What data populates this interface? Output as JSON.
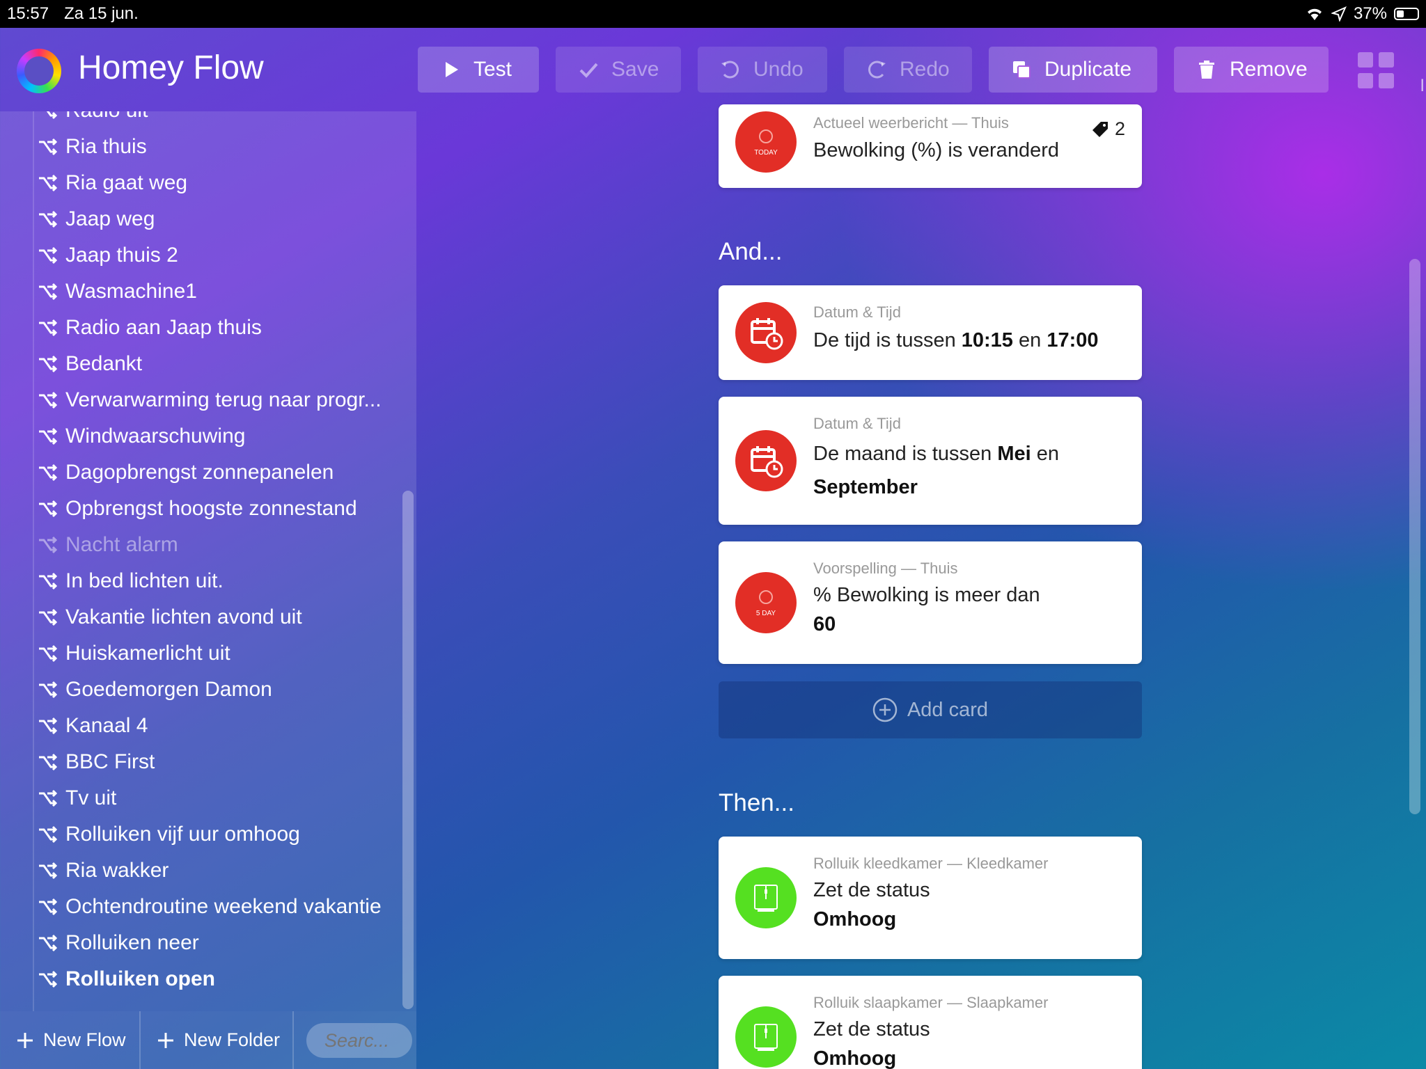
{
  "status_bar": {
    "time": "15:57",
    "date": "Za 15 jun.",
    "battery": "37%"
  },
  "app": {
    "title": "Homey Flow"
  },
  "toolbar": {
    "test": "Test",
    "save": "Save",
    "undo": "Undo",
    "redo": "Redo",
    "duplicate": "Duplicate",
    "remove": "Remove"
  },
  "sidebar": {
    "items": [
      {
        "label": "Radio uit",
        "state": "normal"
      },
      {
        "label": "Ria thuis",
        "state": "normal"
      },
      {
        "label": "Ria gaat weg",
        "state": "normal"
      },
      {
        "label": "Jaap weg",
        "state": "normal"
      },
      {
        "label": "Jaap thuis 2",
        "state": "normal"
      },
      {
        "label": "Wasmachine1",
        "state": "normal"
      },
      {
        "label": "Radio aan Jaap thuis",
        "state": "normal"
      },
      {
        "label": "Bedankt",
        "state": "normal"
      },
      {
        "label": "Verwarwarming terug naar progr...",
        "state": "normal"
      },
      {
        "label": "Windwaarschuwing",
        "state": "normal"
      },
      {
        "label": "Dagopbrengst zonnepanelen",
        "state": "normal"
      },
      {
        "label": "Opbrengst hoogste zonnestand",
        "state": "normal"
      },
      {
        "label": "Nacht alarm",
        "state": "disabled"
      },
      {
        "label": "In bed lichten uit.",
        "state": "normal"
      },
      {
        "label": "Vakantie lichten avond uit",
        "state": "normal"
      },
      {
        "label": "Huiskamerlicht uit",
        "state": "normal"
      },
      {
        "label": "Goedemorgen Damon",
        "state": "normal"
      },
      {
        "label": "Kanaal 4",
        "state": "normal"
      },
      {
        "label": "BBC First",
        "state": "normal"
      },
      {
        "label": "Tv uit",
        "state": "normal"
      },
      {
        "label": "Rolluiken vijf uur omhoog",
        "state": "normal"
      },
      {
        "label": "Ria wakker",
        "state": "normal"
      },
      {
        "label": "Ochtendroutine weekend vakantie",
        "state": "normal"
      },
      {
        "label": "Rolluiken neer",
        "state": "normal"
      },
      {
        "label": "Rolluiken open",
        "state": "active"
      }
    ],
    "footer": {
      "new_flow": "New Flow",
      "new_folder": "New Folder",
      "search_placeholder": "Searc..."
    }
  },
  "when_card": {
    "subtitle": "Actueel weerbericht — Thuis",
    "text": "Bewolking (%) is veranderd",
    "badge_text": "TODAY",
    "tag_count": "2"
  },
  "and": {
    "heading": "And...",
    "cards": [
      {
        "subtitle": "Datum & Tijd",
        "t1": "De tijd is tussen ",
        "b1": "10:15",
        "t2": " en ",
        "b2": "17:00"
      },
      {
        "subtitle": "Datum & Tijd",
        "t1": "De maand is tussen ",
        "b1": "Mei",
        "t2": " en",
        "b2": "September"
      },
      {
        "subtitle": "Voorspelling — Thuis",
        "t1": "% Bewolking is meer dan",
        "b1": "60",
        "badge_text": "5 DAY"
      }
    ],
    "add_card": "Add card"
  },
  "then": {
    "heading": "Then...",
    "cards": [
      {
        "subtitle": "Rolluik kleedkamer — Kleedkamer",
        "t1": "Zet de status",
        "b1": "Omhoog"
      },
      {
        "subtitle": "Rolluik slaapkamer — Slaapkamer",
        "t1": "Zet de status",
        "b1": "Omhoog"
      }
    ]
  },
  "colors": {
    "red": "#e22e26",
    "green": "#55e021"
  }
}
